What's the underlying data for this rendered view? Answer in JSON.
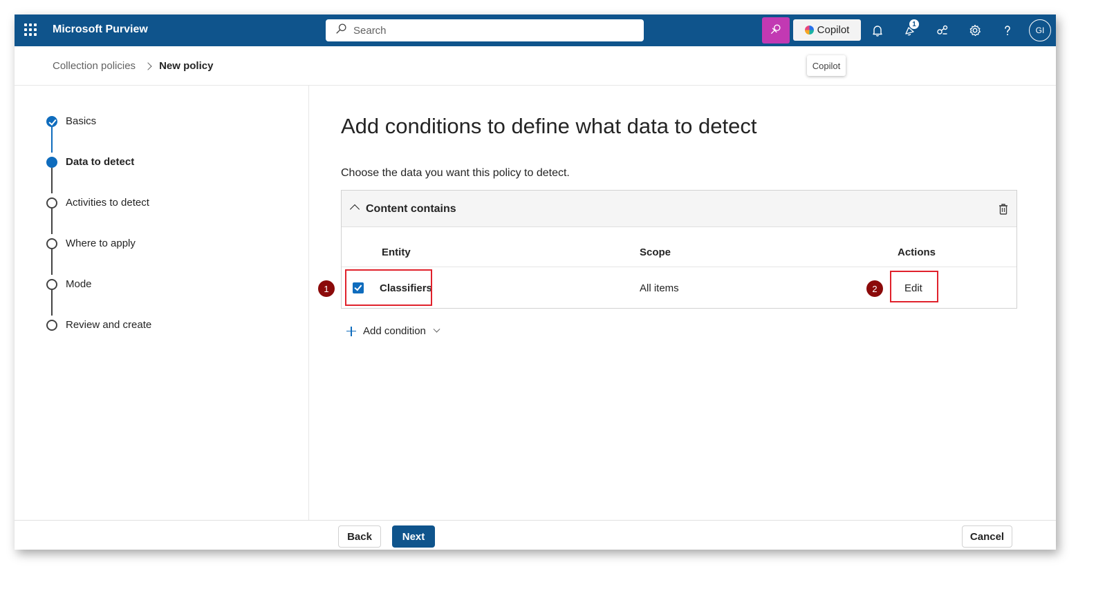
{
  "header": {
    "app_title": "Microsoft Purview",
    "search_placeholder": "Search",
    "copilot_label": "Copilot",
    "notification_count": "1",
    "avatar_initials": "GI",
    "brand_color": "#0f548c",
    "security_copilot_color": "#c239b3",
    "icons": [
      "app-launcher-icon",
      "search-icon",
      "security-copilot-icon",
      "copilot-icon",
      "bell-icon",
      "whats-new-icon",
      "connections-icon",
      "gear-icon",
      "help-icon"
    ]
  },
  "tooltip": {
    "text": "Copilot"
  },
  "breadcrumb": {
    "parent": "Collection policies",
    "current": "New policy"
  },
  "wizard": {
    "steps": [
      {
        "label": "Basics",
        "state": "completed"
      },
      {
        "label": "Data to detect",
        "state": "current"
      },
      {
        "label": "Activities to detect",
        "state": "pending"
      },
      {
        "label": "Where to apply",
        "state": "pending"
      },
      {
        "label": "Mode",
        "state": "pending"
      },
      {
        "label": "Review and create",
        "state": "pending"
      }
    ]
  },
  "main": {
    "title": "Add conditions to define what data to detect",
    "description": "Choose the data you want this policy to detect.",
    "condition_group": {
      "title": "Content contains",
      "columns": {
        "entity": "Entity",
        "scope": "Scope",
        "actions": "Actions"
      },
      "rows": [
        {
          "entity": "Classifiers",
          "scope": "All items",
          "action": "Edit",
          "checked": true
        }
      ]
    },
    "add_condition_label": "Add condition"
  },
  "annotations": {
    "marker_1": "1",
    "marker_2": "2",
    "highlight_color": "#e0212b",
    "marker_color": "#8b0a0a"
  },
  "footer": {
    "back_label": "Back",
    "next_label": "Next",
    "cancel_label": "Cancel"
  }
}
